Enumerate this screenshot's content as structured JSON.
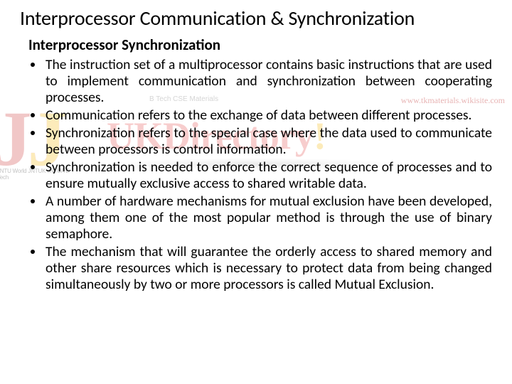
{
  "title": "Interprocessor Communication & Synchronization",
  "subtitle": "Interprocessor Synchronization",
  "bullets": [
    "The instruction set of a multiprocessor contains basic instructions that are used to implement communication and synchronization between cooperating processes.",
    "Communication refers to the exchange of data between different processes.",
    "Synchronization refers to the special case where the data used to communicate between processors is control information.",
    "Synchronization is needed to enforce the correct sequence of   processes and to ensure mutually exclusive access to shared writable data.",
    "A number of hardware mechanisms for mutual exclusion have been developed, among them one of the most popular method is through the use of binary semaphore.",
    "The mechanism that will guarantee the orderly access to shared memory and other share resources which is necessary to protect data from being changed simultaneously by two or more processors is called Mutual Exclusion."
  ],
  "watermark": {
    "logo_letters": "JJ",
    "logo_sub": "JNTU World JNTUK JNTUA B Tech",
    "caption": "B Tech CSE Materials",
    "url": "www.tkmaterials.wikisite.com",
    "banner_uk": "UK",
    "banner_dir": "Directory",
    "banner_bang": "!"
  }
}
